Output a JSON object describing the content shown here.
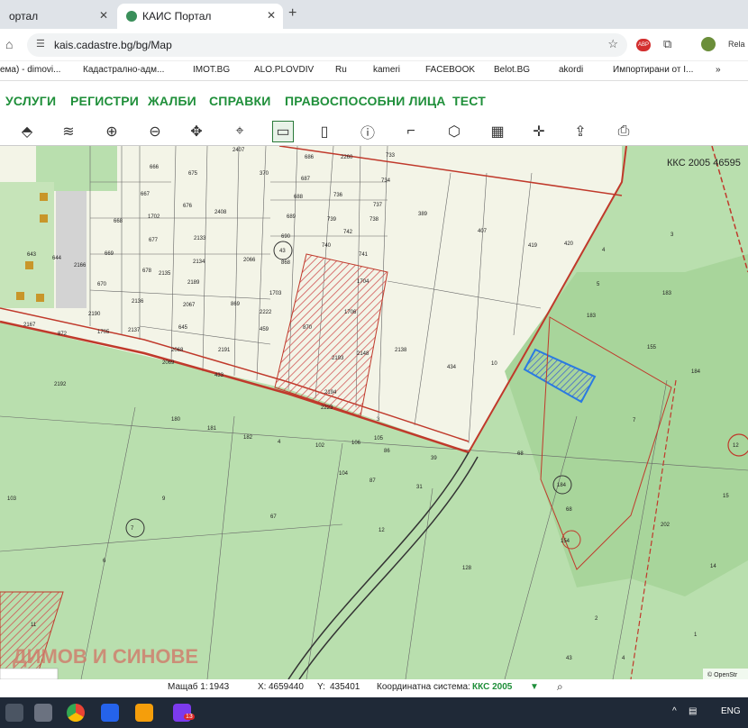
{
  "browser": {
    "tab1_title": "ортал",
    "tab2_title": "КАИС Портал",
    "url": "kais.cadastre.bg/bg/Map",
    "profile_label": "Rela",
    "extension_badge": "ABP"
  },
  "bookmarks": [
    "ема) - dimovi...",
    "Кадастрално-адм...",
    "IMOT.BG",
    "ALO.PLOVDIV",
    "Ru",
    "kameri",
    "FACEBOOK",
    "Belot.BG",
    "akordi",
    "Импортирани от I..."
  ],
  "menu": [
    "УСЛУГИ",
    "РЕГИСТРИ",
    "ЖАЛБИ",
    "СПРАВКИ",
    "ПРАВОСПОСОБНИ ЛИЦА",
    "ТЕСТ"
  ],
  "toolbar_icons": [
    "layers-icon",
    "layers-stack-icon",
    "zoom-in-icon",
    "zoom-out-icon",
    "pan-icon",
    "locate-icon",
    "select-rect-icon",
    "select-area-icon",
    "info-icon",
    "measure-icon",
    "shape-icon",
    "map-icon",
    "crosshair-icon",
    "export-icon",
    "print-icon"
  ],
  "map": {
    "coord_system_label_top": "ККС 2005 46595",
    "watermark": "ДИМОВ И СИНОВЕ",
    "attribution": "© OpenStr",
    "parcel_labels": [
      "666",
      "675",
      "2407",
      "370",
      "686",
      "2260",
      "733",
      "667",
      "676",
      "687",
      "736",
      "734",
      "668",
      "1702",
      "2408",
      "688",
      "737",
      "677",
      "2133",
      "689",
      "739",
      "738",
      "389",
      "407",
      "419",
      "420",
      "690",
      "742",
      "740",
      "741",
      "643",
      "644",
      "2166",
      "669",
      "2134",
      "2066",
      "868",
      "43",
      "678",
      "2135",
      "670",
      "2189",
      "1704",
      "2136",
      "2067",
      "869",
      "1703",
      "2190",
      "1706",
      "1705",
      "2137",
      "645",
      "2167",
      "872",
      "459",
      "870",
      "2222",
      "2138",
      "2068",
      "2191",
      "2193",
      "2148",
      "2069",
      "433",
      "434",
      "10",
      "2192",
      "2194",
      "2223",
      "3",
      "180",
      "181",
      "182",
      "4",
      "102",
      "106",
      "105",
      "86",
      "39",
      "103",
      "104",
      "87",
      "31",
      "9",
      "67",
      "7",
      "12",
      "6",
      "128",
      "11",
      "2",
      "3",
      "4",
      "5",
      "183",
      "183",
      "155",
      "184",
      "7",
      "68",
      "184",
      "68",
      "154",
      "202",
      "14",
      "12",
      "15",
      "1",
      "4",
      "43"
    ],
    "scale_label": "Мащаб 1:",
    "scale_value": "1943",
    "x_label": "X:",
    "x_value": "4659440",
    "y_label": "Y:",
    "y_value": "435401",
    "coord_label": "Координатна система:",
    "coord_value": "ККС 2005"
  },
  "taskbar": {
    "badge": "13",
    "lang": "ENG"
  },
  "colors": {
    "menu_green": "#1f8f3a",
    "parcel_red": "#c0392b",
    "selected_blue": "#2a7ae2",
    "field_green": "#b9dfae"
  }
}
